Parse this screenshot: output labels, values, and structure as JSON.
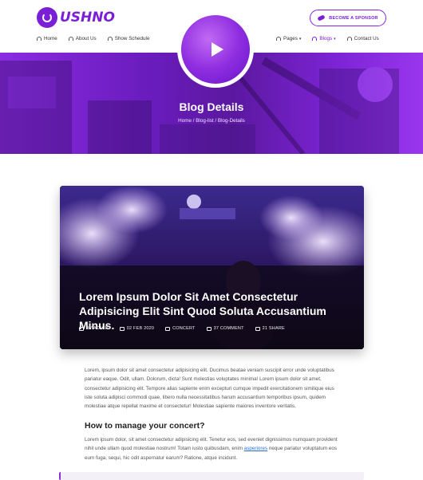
{
  "brand": {
    "logo_text": "USHNO",
    "accent": "#7b1fd6"
  },
  "header": {
    "sponsor_label": "BECOME A SPONSOR",
    "nav_left": [
      {
        "label": "Home"
      },
      {
        "label": "About Us"
      },
      {
        "label": "Show Schedule"
      }
    ],
    "nav_right": [
      {
        "label": "Pages"
      },
      {
        "label": "Blogs"
      },
      {
        "label": "Contact Us"
      }
    ]
  },
  "hero": {
    "title": "Blog Details",
    "breadcrumb": [
      "Home",
      "Blog-list",
      "Blog-Details"
    ]
  },
  "post": {
    "title": "Lorem Ipsum Dolor Sit Amet Consectetur Adipisicing Elit Sint Quod Soluta Accusantium Minus.",
    "meta": {
      "author": "BY ADMIN",
      "date": "02 FEB 2020",
      "category": "CONCERT",
      "comments": "37 COMMENT",
      "shares": "21 SHARE"
    },
    "paragraph1": "Lorem, ipsum dolor sit amet consectetur adipisicing elit. Ducimus beatae veniam suscipit error unde voluptatibus pariatur eaque. Odit, ullam. Dolorum, dicta! Sunt molestias voluptates minima! Lorem ipsum dolor sit amet, consectetur adipisicing elit. Tempore alias sapiente enim excepturi cumque impedit exercitationem similique eius iste soluta adipisci commodi quae, libero nulla necessitatibus harum accusantium temporibus ipsum, quidem molestiae atque repellat maxime et consectetur! Molestiae sapiente maiores inventore veritatis.",
    "subheading": "How to manage your concert?",
    "paragraph2_before": "Lorem ipsum dolor, sit amet consectetur adipisicing elit. Tenetur eos, sed eveniet dignissimos numquam provident nihil unde ullam quod molestiae nostrum! Totam iusto quibusdam, enim ",
    "paragraph2_link": "asperiores",
    "paragraph2_after": " neque pariatur voluptatum eos eum fuga, sequi, hic odit aspernatur earum? Ratione, atque incidunt."
  }
}
